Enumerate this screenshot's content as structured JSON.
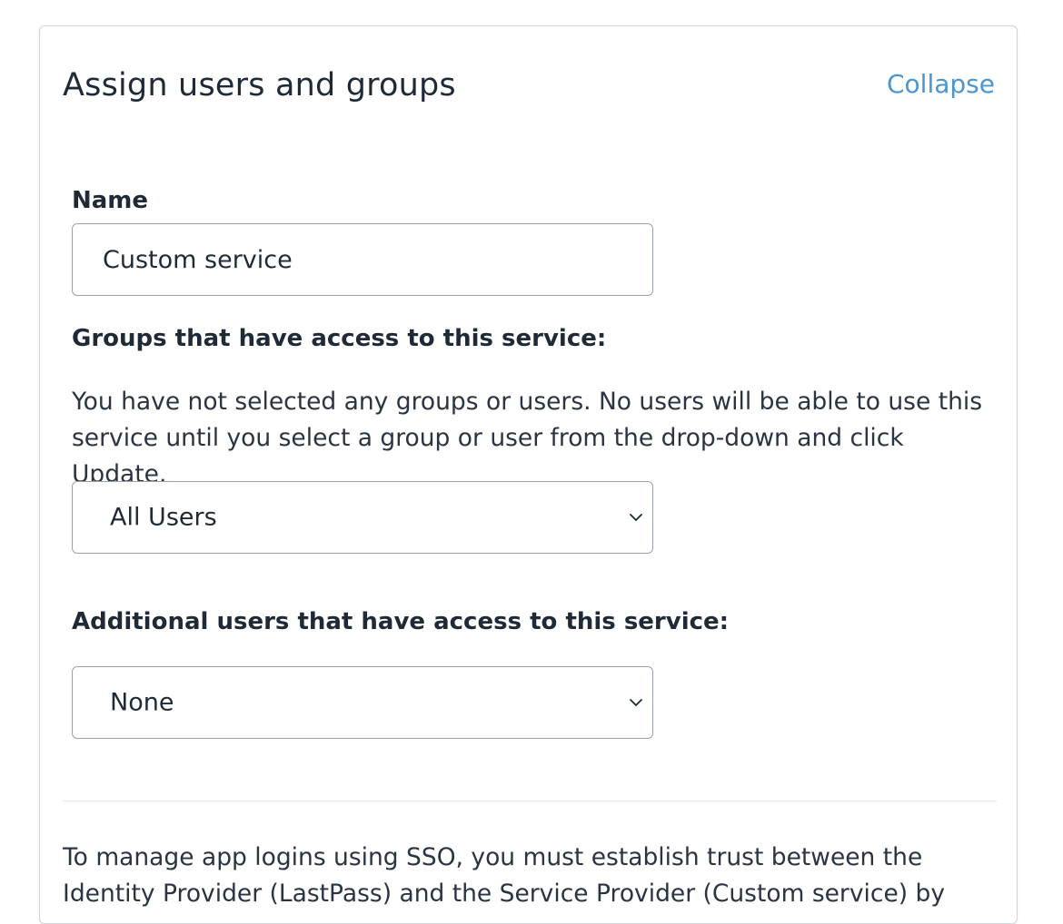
{
  "panel": {
    "title": "Assign users and groups",
    "collapse_label": "Collapse"
  },
  "name_field": {
    "label": "Name",
    "value": "Custom service"
  },
  "groups": {
    "label": "Groups that have access to this service:",
    "help_text": "You have not selected any groups or users. No users will be able to use this service until you select a group or user from the drop-down and click Update.",
    "selected": "All Users"
  },
  "additional_users": {
    "label": "Additional users that have access to this service:",
    "selected": "None"
  },
  "sso_info": {
    "text": "To manage app logins using SSO, you must establish trust between the Identity Provider (LastPass) and the Service Provider (Custom service) by"
  },
  "colors": {
    "link": "#4a96cf",
    "border": "#9aa1ab",
    "text": "#1f2a37"
  },
  "icons": {
    "dropdown": "chevron-down-icon"
  }
}
